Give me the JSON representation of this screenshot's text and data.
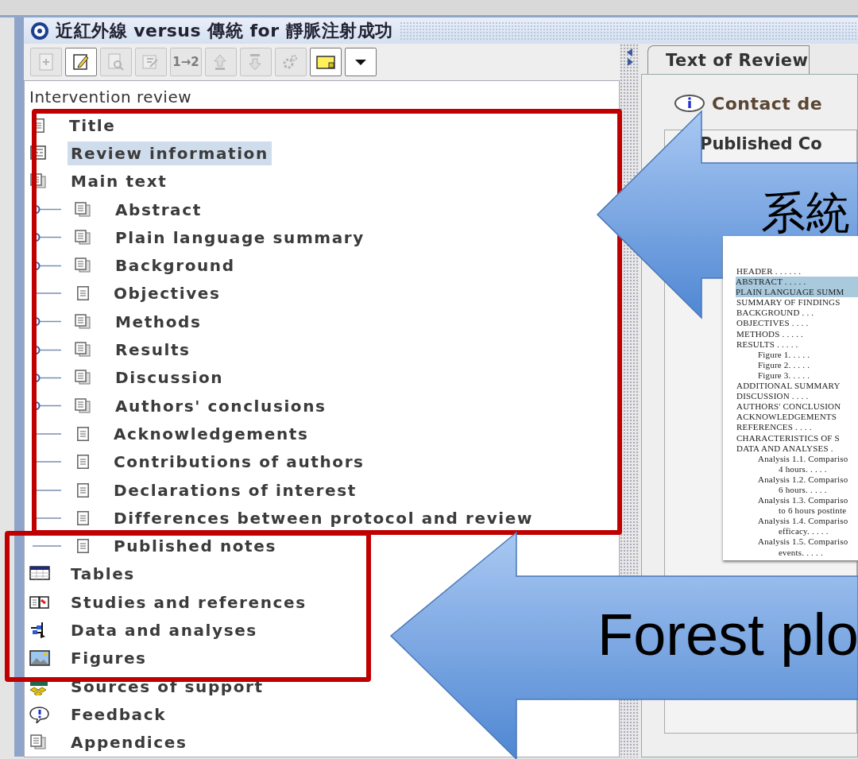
{
  "window": {
    "title": "近紅外線 versus 傳統 for 靜脈注射成功"
  },
  "toolbar": [
    {
      "kind": "add",
      "disabled": true
    },
    {
      "kind": "edit",
      "disabled": false
    },
    {
      "kind": "find",
      "disabled": true
    },
    {
      "kind": "edit-doc",
      "disabled": true
    },
    {
      "kind": "text",
      "label": "1→2",
      "disabled": true
    },
    {
      "kind": "up",
      "disabled": true
    },
    {
      "kind": "down",
      "disabled": true
    },
    {
      "kind": "gear",
      "disabled": true
    },
    {
      "kind": "note",
      "disabled": false
    },
    {
      "kind": "dropdown",
      "disabled": false
    }
  ],
  "tree": {
    "heading": "Intervention review",
    "items": [
      {
        "label": "Title",
        "kind": "page",
        "selected": false
      },
      {
        "label": "Review information",
        "kind": "form",
        "selected": true
      },
      {
        "label": "Main text",
        "kind": "pages",
        "selected": false,
        "children": [
          {
            "label": "Abstract",
            "kind": "pages",
            "selected": false,
            "expandable": true
          },
          {
            "label": "Plain language summary",
            "kind": "pages",
            "selected": false,
            "expandable": true
          },
          {
            "label": "Background",
            "kind": "pages",
            "selected": false,
            "expandable": true
          },
          {
            "label": "Objectives",
            "kind": "page",
            "selected": false,
            "expandable": false
          },
          {
            "label": "Methods",
            "kind": "pages",
            "selected": false,
            "expandable": true
          },
          {
            "label": "Results",
            "kind": "pages",
            "selected": false,
            "expandable": true
          },
          {
            "label": "Discussion",
            "kind": "pages",
            "selected": false,
            "expandable": true
          },
          {
            "label": "Authors' conclusions",
            "kind": "pages",
            "selected": false,
            "expandable": true
          },
          {
            "label": "Acknowledgements",
            "kind": "page",
            "selected": false,
            "expandable": false
          },
          {
            "label": "Contributions of authors",
            "kind": "page",
            "selected": false,
            "expandable": false
          },
          {
            "label": "Declarations of interest",
            "kind": "page",
            "selected": false,
            "expandable": false
          },
          {
            "label": "Differences between protocol and review",
            "kind": "page",
            "selected": false,
            "expandable": false
          },
          {
            "label": "Published notes",
            "kind": "page",
            "selected": false,
            "expandable": false
          }
        ]
      },
      {
        "label": "Tables",
        "kind": "table",
        "selected": false
      },
      {
        "label": "Studies and references",
        "kind": "book",
        "selected": false
      },
      {
        "label": "Data and analyses",
        "kind": "analysis",
        "selected": false
      },
      {
        "label": "Figures",
        "kind": "image",
        "selected": false
      },
      {
        "label": "Sources of support",
        "kind": "support",
        "selected": false
      },
      {
        "label": "Feedback",
        "kind": "feedback",
        "selected": false
      },
      {
        "label": "Appendices",
        "kind": "pages",
        "selected": false
      }
    ]
  },
  "editor": {
    "tab": "Text of Review",
    "contact": "Contact de",
    "section": "Published Co"
  },
  "callouts": [
    {
      "text": "系統"
    },
    {
      "text": "Forest plo"
    }
  ],
  "document_contents": [
    {
      "text": "HEADER . . . . . .",
      "highlighted": false
    },
    {
      "text": "ABSTRACT . . . . .",
      "highlighted": true
    },
    {
      "text": "PLAIN LANGUAGE SUMM",
      "highlighted": true
    },
    {
      "text": "SUMMARY OF FINDINGS",
      "highlighted": false
    },
    {
      "text": "BACKGROUND . . .",
      "highlighted": false
    },
    {
      "text": "OBJECTIVES . . . .",
      "highlighted": false
    },
    {
      "text": "METHODS . . . . .",
      "highlighted": false
    },
    {
      "text": "RESULTS . . . . .",
      "highlighted": false,
      "children": [
        {
          "text": "Figure 1. . . . ."
        },
        {
          "text": "Figure 2. . . . ."
        },
        {
          "text": "Figure 3. . . . ."
        }
      ]
    },
    {
      "text": "ADDITIONAL SUMMARY",
      "highlighted": false
    },
    {
      "text": "DISCUSSION . . . .",
      "highlighted": false
    },
    {
      "text": "AUTHORS' CONCLUSION",
      "highlighted": false
    },
    {
      "text": "ACKNOWLEDGEMENTS",
      "highlighted": false
    },
    {
      "text": "REFERENCES . . . .",
      "highlighted": false
    },
    {
      "text": "CHARACTERISTICS OF S",
      "highlighted": false
    },
    {
      "text": "DATA AND ANALYSES .",
      "highlighted": false,
      "children": [
        {
          "text": "Analysis 1.1. Compariso",
          "continuation": "4 hours. . . . ."
        },
        {
          "text": "Analysis 1.2. Compariso",
          "continuation": "6 hours. . . . ."
        },
        {
          "text": "Analysis 1.3. Compariso",
          "continuation": "to 6 hours postinte"
        },
        {
          "text": "Analysis 1.4. Compariso",
          "continuation": "efficacy. . . . ."
        },
        {
          "text": "Analysis 1.5. Compariso",
          "continuation": "events. . . . ."
        }
      ]
    }
  ]
}
